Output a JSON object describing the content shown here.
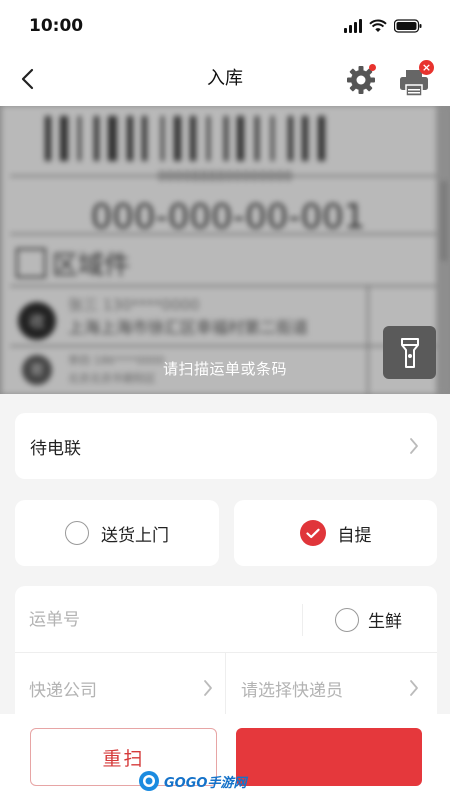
{
  "status_bar": {
    "time": "10:00"
  },
  "header": {
    "title": "入库"
  },
  "scanner": {
    "hint": "请扫描运单或条码",
    "label_mock": {
      "barcode_small": "0000888800000000",
      "number": "000-000-00-001",
      "zone_tag": "区域件",
      "receiver_line1": "张三 130****0000",
      "receiver_line2": "上海上海市徐汇区幸福村第二街道",
      "sender_line1": "李四 186****0000",
      "sender_line2": "北京北京市朝阳区",
      "receiver_badge": "收",
      "sender_badge": "寄"
    }
  },
  "contact_status": {
    "label": "待电联"
  },
  "delivery_options": {
    "delivery_label": "送货上门",
    "pickup_label": "自提",
    "selected": "pickup"
  },
  "form": {
    "waybill_placeholder": "运单号",
    "fresh_label": "生鲜",
    "company_placeholder": "快递公司",
    "courier_placeholder": "请选择快递员"
  },
  "actions": {
    "rescan_label": "重扫",
    "submit_label": ""
  },
  "watermark": {
    "text": "GOGO手游网"
  },
  "colors": {
    "accent": "#e5383c",
    "placeholder": "#b3b3b3",
    "background": "#f4f4f4"
  }
}
